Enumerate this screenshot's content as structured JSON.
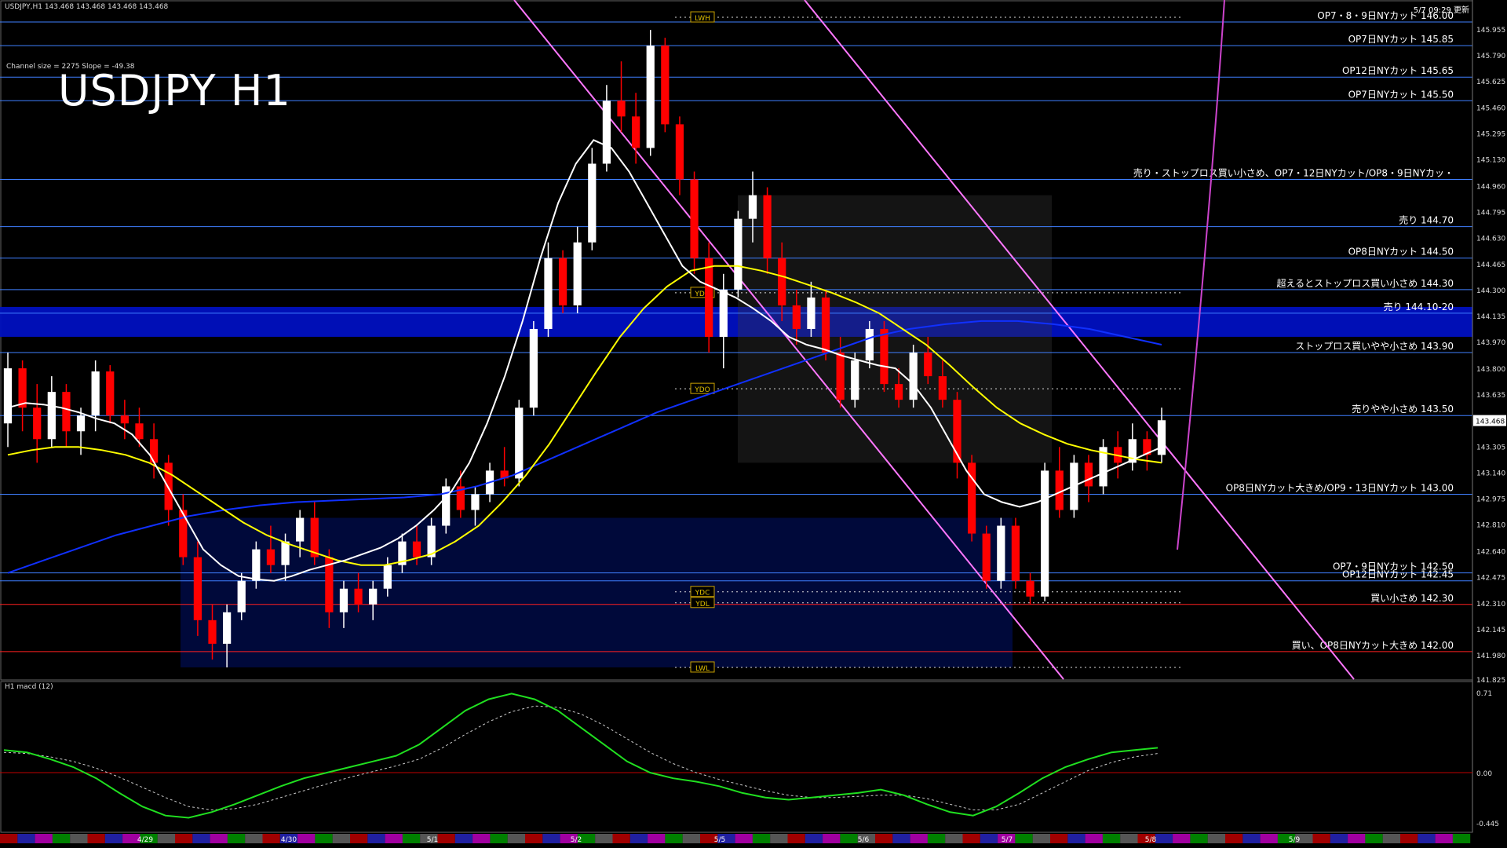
{
  "header": {
    "symbol_line": "USDJPY,H1  143.468 143.468 143.468 143.468",
    "title": "USDJPY H1",
    "channel_info": "Channel size = 2275 Slope = -49.38",
    "timestamp": "5/7 09:29 更新"
  },
  "subwindow": {
    "label": "H1 macd (12)"
  },
  "colors": {
    "bull": "#ffffff",
    "bear": "#ff0000",
    "level_line": "#3f7fff",
    "sma_fast": "#ffffff",
    "sma_slow": "#ffff00",
    "ma_blue": "#1030ff",
    "rsi_green": "#00c000",
    "channel": "#ff77ff",
    "band": "#0010c0",
    "macd": "#20e020",
    "macd_neg": "#ff6090",
    "signal": "#cccccc"
  },
  "chart_data": {
    "type": "candlestick",
    "ylim": [
      141.825,
      146.1
    ],
    "y_ticks": [
      "145.955",
      "145.790",
      "145.625",
      "145.460",
      "145.295",
      "145.130",
      "144.960",
      "144.795",
      "144.630",
      "144.465",
      "144.300",
      "144.135",
      "143.970",
      "143.800",
      "143.635",
      "143.470",
      "143.305",
      "143.140",
      "142.975",
      "142.810",
      "142.640",
      "142.475",
      "142.310",
      "142.145",
      "141.980",
      "141.825"
    ],
    "current_price": "143.468",
    "sell_band": [
      144.04,
      144.14
    ],
    "x_labels": [
      "4/29",
      "4/30",
      "5/1",
      "5/2",
      "5/5",
      "5/6",
      "5/7",
      "5/8",
      "5/9"
    ],
    "levels": [
      {
        "label": "OP7・8・9日NYカット 146.00",
        "value": 146.0,
        "color": "#3f7fff"
      },
      {
        "label": "OP7日NYカット 145.85",
        "value": 145.85,
        "color": "#3f7fff"
      },
      {
        "label": "OP12日NYカット 145.65",
        "value": 145.65,
        "color": "#3f7fff"
      },
      {
        "label": "OP7日NYカット 145.50",
        "value": 145.5,
        "color": "#3f7fff"
      },
      {
        "label": "売り・ストップロス買い小さめ、OP7・12日NYカット/OP8・9日NYカッ・",
        "value": 145.0,
        "color": "#3f7fff"
      },
      {
        "label": "売り 144.70",
        "value": 144.7,
        "color": "#3f7fff"
      },
      {
        "label": "OP8日NYカット 144.50",
        "value": 144.5,
        "color": "#3f7fff"
      },
      {
        "label": "超えるとストップロス買い小さめ 144.30",
        "value": 144.3,
        "color": "#3f7fff"
      },
      {
        "label": "売り 144.10-20",
        "value": 144.15,
        "color": "#3f7fff"
      },
      {
        "label": "ストップロス買いやや小さめ 143.90",
        "value": 143.9,
        "color": "#3f7fff"
      },
      {
        "label": "売りやや小さめ 143.50",
        "value": 143.5,
        "color": "#3f7fff"
      },
      {
        "label": "OP8日NYカット大きめ/OP9・13日NYカット 143.00",
        "value": 143.0,
        "color": "#3f7fff"
      },
      {
        "label": "OP7・9日NYカット 142.50",
        "value": 142.5,
        "color": "#3f7fff"
      },
      {
        "label": "OP12日NYカット 142.45",
        "value": 142.45,
        "color": "#3f7fff"
      },
      {
        "label": "買い小さめ 142.30",
        "value": 142.3,
        "color": "#ff2020"
      },
      {
        "label": "買い、OP8日NYカット大きめ 142.00",
        "value": 142.0,
        "color": "#ff2020"
      }
    ],
    "markers": [
      {
        "label": "LWH",
        "value": 146.03
      },
      {
        "label": "YDH",
        "value": 144.28
      },
      {
        "label": "YDO",
        "value": 143.67
      },
      {
        "label": "YDC",
        "value": 142.38
      },
      {
        "label": "YDL",
        "value": 142.31
      },
      {
        "label": "LWL",
        "value": 141.9
      }
    ],
    "candles": [
      {
        "o": 143.45,
        "h": 143.9,
        "l": 143.3,
        "c": 143.8
      },
      {
        "o": 143.8,
        "h": 143.85,
        "l": 143.4,
        "c": 143.55
      },
      {
        "o": 143.55,
        "h": 143.7,
        "l": 143.2,
        "c": 143.35
      },
      {
        "o": 143.35,
        "h": 143.75,
        "l": 143.3,
        "c": 143.65
      },
      {
        "o": 143.65,
        "h": 143.7,
        "l": 143.3,
        "c": 143.4
      },
      {
        "o": 143.4,
        "h": 143.55,
        "l": 143.25,
        "c": 143.5
      },
      {
        "o": 143.5,
        "h": 143.85,
        "l": 143.4,
        "c": 143.78
      },
      {
        "o": 143.78,
        "h": 143.82,
        "l": 143.45,
        "c": 143.5
      },
      {
        "o": 143.5,
        "h": 143.6,
        "l": 143.35,
        "c": 143.45
      },
      {
        "o": 143.45,
        "h": 143.55,
        "l": 143.3,
        "c": 143.35
      },
      {
        "o": 143.35,
        "h": 143.45,
        "l": 143.1,
        "c": 143.2
      },
      {
        "o": 143.2,
        "h": 143.25,
        "l": 142.8,
        "c": 142.9
      },
      {
        "o": 142.9,
        "h": 143.0,
        "l": 142.55,
        "c": 142.6
      },
      {
        "o": 142.6,
        "h": 142.7,
        "l": 142.1,
        "c": 142.2
      },
      {
        "o": 142.2,
        "h": 142.3,
        "l": 141.95,
        "c": 142.05
      },
      {
        "o": 142.05,
        "h": 142.3,
        "l": 141.9,
        "c": 142.25
      },
      {
        "o": 142.25,
        "h": 142.5,
        "l": 142.2,
        "c": 142.45
      },
      {
        "o": 142.45,
        "h": 142.7,
        "l": 142.4,
        "c": 142.65
      },
      {
        "o": 142.65,
        "h": 142.8,
        "l": 142.5,
        "c": 142.55
      },
      {
        "o": 142.55,
        "h": 142.75,
        "l": 142.45,
        "c": 142.7
      },
      {
        "o": 142.7,
        "h": 142.9,
        "l": 142.6,
        "c": 142.85
      },
      {
        "o": 142.85,
        "h": 142.95,
        "l": 142.55,
        "c": 142.6
      },
      {
        "o": 142.6,
        "h": 142.65,
        "l": 142.15,
        "c": 142.25
      },
      {
        "o": 142.25,
        "h": 142.45,
        "l": 142.15,
        "c": 142.4
      },
      {
        "o": 142.4,
        "h": 142.5,
        "l": 142.25,
        "c": 142.3
      },
      {
        "o": 142.3,
        "h": 142.45,
        "l": 142.2,
        "c": 142.4
      },
      {
        "o": 142.4,
        "h": 142.6,
        "l": 142.35,
        "c": 142.55
      },
      {
        "o": 142.55,
        "h": 142.75,
        "l": 142.5,
        "c": 142.7
      },
      {
        "o": 142.7,
        "h": 142.8,
        "l": 142.55,
        "c": 142.6
      },
      {
        "o": 142.6,
        "h": 142.85,
        "l": 142.55,
        "c": 142.8
      },
      {
        "o": 142.8,
        "h": 143.1,
        "l": 142.75,
        "c": 143.05
      },
      {
        "o": 143.05,
        "h": 143.15,
        "l": 142.85,
        "c": 142.9
      },
      {
        "o": 142.9,
        "h": 143.05,
        "l": 142.8,
        "c": 143.0
      },
      {
        "o": 143.0,
        "h": 143.2,
        "l": 142.95,
        "c": 143.15
      },
      {
        "o": 143.15,
        "h": 143.3,
        "l": 143.05,
        "c": 143.1
      },
      {
        "o": 143.1,
        "h": 143.6,
        "l": 143.05,
        "c": 143.55
      },
      {
        "o": 143.55,
        "h": 144.1,
        "l": 143.5,
        "c": 144.05
      },
      {
        "o": 144.05,
        "h": 144.6,
        "l": 144.0,
        "c": 144.5
      },
      {
        "o": 144.5,
        "h": 144.55,
        "l": 144.15,
        "c": 144.2
      },
      {
        "o": 144.2,
        "h": 144.7,
        "l": 144.15,
        "c": 144.6
      },
      {
        "o": 144.6,
        "h": 145.2,
        "l": 144.55,
        "c": 145.1
      },
      {
        "o": 145.1,
        "h": 145.6,
        "l": 145.05,
        "c": 145.5
      },
      {
        "o": 145.5,
        "h": 145.75,
        "l": 145.3,
        "c": 145.4
      },
      {
        "o": 145.4,
        "h": 145.55,
        "l": 145.1,
        "c": 145.2
      },
      {
        "o": 145.2,
        "h": 145.95,
        "l": 145.15,
        "c": 145.85
      },
      {
        "o": 145.85,
        "h": 145.9,
        "l": 145.3,
        "c": 145.35
      },
      {
        "o": 145.35,
        "h": 145.4,
        "l": 144.9,
        "c": 145.0
      },
      {
        "o": 145.0,
        "h": 145.05,
        "l": 144.4,
        "c": 144.5
      },
      {
        "o": 144.5,
        "h": 144.6,
        "l": 143.9,
        "c": 144.0
      },
      {
        "o": 144.0,
        "h": 144.4,
        "l": 143.8,
        "c": 144.3
      },
      {
        "o": 144.3,
        "h": 144.8,
        "l": 144.25,
        "c": 144.75
      },
      {
        "o": 144.75,
        "h": 145.05,
        "l": 144.6,
        "c": 144.9
      },
      {
        "o": 144.9,
        "h": 144.95,
        "l": 144.4,
        "c": 144.5
      },
      {
        "o": 144.5,
        "h": 144.6,
        "l": 144.1,
        "c": 144.2
      },
      {
        "o": 144.2,
        "h": 144.3,
        "l": 143.95,
        "c": 144.05
      },
      {
        "o": 144.05,
        "h": 144.35,
        "l": 144.0,
        "c": 144.25
      },
      {
        "o": 144.25,
        "h": 144.3,
        "l": 143.85,
        "c": 143.9
      },
      {
        "o": 143.9,
        "h": 144.0,
        "l": 143.55,
        "c": 143.6
      },
      {
        "o": 143.6,
        "h": 143.9,
        "l": 143.55,
        "c": 143.85
      },
      {
        "o": 143.85,
        "h": 144.1,
        "l": 143.8,
        "c": 144.05
      },
      {
        "o": 144.05,
        "h": 144.1,
        "l": 143.65,
        "c": 143.7
      },
      {
        "o": 143.7,
        "h": 143.8,
        "l": 143.55,
        "c": 143.6
      },
      {
        "o": 143.6,
        "h": 143.95,
        "l": 143.55,
        "c": 143.9
      },
      {
        "o": 143.9,
        "h": 144.0,
        "l": 143.7,
        "c": 143.75
      },
      {
        "o": 143.75,
        "h": 143.85,
        "l": 143.55,
        "c": 143.6
      },
      {
        "o": 143.6,
        "h": 143.65,
        "l": 143.1,
        "c": 143.2
      },
      {
        "o": 143.2,
        "h": 143.25,
        "l": 142.7,
        "c": 142.75
      },
      {
        "o": 142.75,
        "h": 142.8,
        "l": 142.4,
        "c": 142.45
      },
      {
        "o": 142.45,
        "h": 142.85,
        "l": 142.4,
        "c": 142.8
      },
      {
        "o": 142.8,
        "h": 142.85,
        "l": 142.4,
        "c": 142.45
      },
      {
        "o": 142.45,
        "h": 142.5,
        "l": 142.3,
        "c": 142.35
      },
      {
        "o": 142.35,
        "h": 143.2,
        "l": 142.32,
        "c": 143.15
      },
      {
        "o": 143.15,
        "h": 143.3,
        "l": 142.85,
        "c": 142.9
      },
      {
        "o": 142.9,
        "h": 143.25,
        "l": 142.85,
        "c": 143.2
      },
      {
        "o": 143.2,
        "h": 143.25,
        "l": 142.95,
        "c": 143.05
      },
      {
        "o": 143.05,
        "h": 143.35,
        "l": 143.0,
        "c": 143.3
      },
      {
        "o": 143.3,
        "h": 143.4,
        "l": 143.1,
        "c": 143.2
      },
      {
        "o": 143.2,
        "h": 143.45,
        "l": 143.15,
        "c": 143.35
      },
      {
        "o": 143.35,
        "h": 143.4,
        "l": 143.15,
        "c": 143.25
      },
      {
        "o": 143.25,
        "h": 143.55,
        "l": 143.2,
        "c": 143.47
      }
    ],
    "sma_fast": [
      143.55,
      143.58,
      143.57,
      143.55,
      143.52,
      143.48,
      143.45,
      143.38,
      143.25,
      143.05,
      142.85,
      142.65,
      142.55,
      142.48,
      142.46,
      142.45,
      142.48,
      142.52,
      142.55,
      142.58,
      142.62,
      142.66,
      142.72,
      142.8,
      142.9,
      143.02,
      143.2,
      143.45,
      143.75,
      144.1,
      144.5,
      144.85,
      145.1,
      145.25,
      145.2,
      145.05,
      144.85,
      144.65,
      144.45,
      144.35,
      144.3,
      144.25,
      144.18,
      144.1,
      144.0,
      143.95,
      143.92,
      143.88,
      143.85,
      143.82,
      143.8,
      143.7,
      143.55,
      143.35,
      143.15,
      143.0,
      142.95,
      142.92,
      142.95,
      143.0,
      143.05,
      143.1,
      143.15,
      143.2,
      143.25,
      143.3
    ],
    "sma_slow": [
      143.25,
      143.28,
      143.3,
      143.3,
      143.28,
      143.25,
      143.2,
      143.12,
      143.02,
      142.92,
      142.82,
      142.74,
      142.68,
      142.63,
      142.58,
      142.55,
      142.55,
      142.58,
      142.62,
      142.7,
      142.8,
      142.95,
      143.12,
      143.32,
      143.55,
      143.78,
      144.0,
      144.18,
      144.32,
      144.42,
      144.45,
      144.45,
      144.42,
      144.38,
      144.33,
      144.28,
      144.22,
      144.15,
      144.05,
      143.95,
      143.82,
      143.68,
      143.55,
      143.45,
      143.38,
      143.32,
      143.28,
      143.25,
      143.22,
      143.2
    ],
    "ma_blue": [
      142.5,
      142.58,
      142.66,
      142.74,
      142.8,
      142.86,
      142.9,
      142.93,
      142.95,
      142.96,
      142.97,
      142.98,
      143.0,
      143.05,
      143.12,
      143.22,
      143.32,
      143.42,
      143.52,
      143.6,
      143.68,
      143.76,
      143.84,
      143.92,
      144.0,
      144.05,
      144.08,
      144.1,
      144.1,
      144.08,
      144.05,
      144.0,
      143.95
    ]
  },
  "macd": {
    "ylim": [
      -0.445,
      0.71
    ],
    "y_ticks": [
      "0.71",
      "0.00",
      "-0.445"
    ],
    "main": [
      0.2,
      0.18,
      0.12,
      0.05,
      -0.05,
      -0.18,
      -0.3,
      -0.38,
      -0.4,
      -0.35,
      -0.28,
      -0.2,
      -0.12,
      -0.05,
      0.0,
      0.05,
      0.1,
      0.15,
      0.25,
      0.4,
      0.55,
      0.65,
      0.7,
      0.65,
      0.55,
      0.4,
      0.25,
      0.1,
      0.0,
      -0.05,
      -0.08,
      -0.12,
      -0.18,
      -0.22,
      -0.24,
      -0.22,
      -0.2,
      -0.18,
      -0.15,
      -0.2,
      -0.28,
      -0.35,
      -0.38,
      -0.3,
      -0.18,
      -0.05,
      0.05,
      0.12,
      0.18,
      0.2,
      0.22
    ],
    "signal": [
      0.18,
      0.17,
      0.14,
      0.1,
      0.04,
      -0.04,
      -0.13,
      -0.22,
      -0.3,
      -0.33,
      -0.32,
      -0.28,
      -0.22,
      -0.16,
      -0.1,
      -0.04,
      0.01,
      0.06,
      0.12,
      0.22,
      0.34,
      0.45,
      0.54,
      0.59,
      0.58,
      0.52,
      0.42,
      0.3,
      0.18,
      0.08,
      0.0,
      -0.06,
      -0.11,
      -0.16,
      -0.2,
      -0.22,
      -0.22,
      -0.21,
      -0.2,
      -0.2,
      -0.23,
      -0.28,
      -0.33,
      -0.33,
      -0.28,
      -0.18,
      -0.08,
      0.02,
      0.09,
      0.14,
      0.17
    ]
  }
}
